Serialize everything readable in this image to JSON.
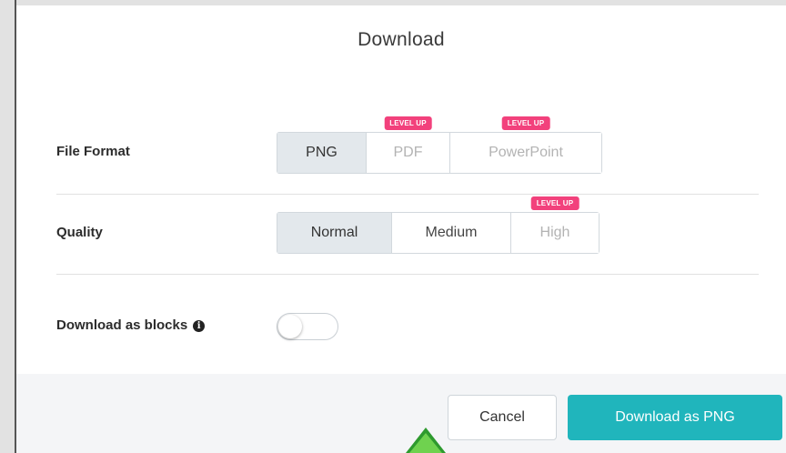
{
  "dialog": {
    "title": "Download"
  },
  "file_format": {
    "label": "File Format",
    "options": [
      {
        "label": "PNG",
        "selected": true,
        "locked": false
      },
      {
        "label": "PDF",
        "selected": false,
        "locked": true,
        "badge": "LEVEL UP"
      },
      {
        "label": "PowerPoint",
        "selected": false,
        "locked": true,
        "badge": "LEVEL UP"
      }
    ]
  },
  "quality": {
    "label": "Quality",
    "options": [
      {
        "label": "Normal",
        "selected": true,
        "locked": false
      },
      {
        "label": "Medium",
        "selected": false,
        "locked": false
      },
      {
        "label": "High",
        "selected": false,
        "locked": true,
        "badge": "LEVEL UP"
      }
    ]
  },
  "blocks": {
    "label": "Download as blocks",
    "info_icon": "info-icon",
    "enabled": false
  },
  "footer": {
    "cancel_label": "Cancel",
    "primary_label": "Download as PNG"
  },
  "colors": {
    "accent": "#20b5bc",
    "badge": "#f2417c",
    "selected_bg": "#e3e8ec",
    "pointer": "#6fd24f"
  }
}
